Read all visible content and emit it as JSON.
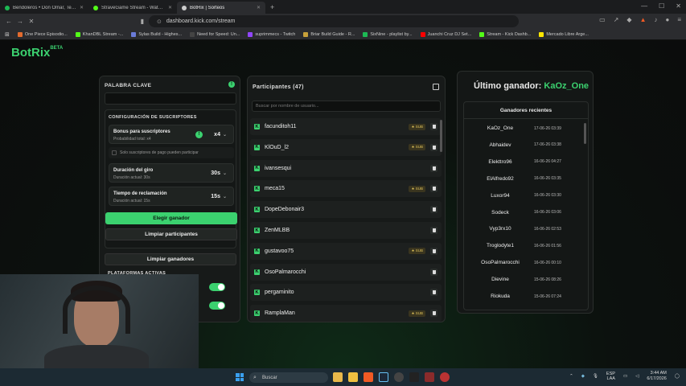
{
  "browser": {
    "tabs": [
      {
        "label": "Bendoleros • Don Omar, Tego Ca",
        "color": "#1db954"
      },
      {
        "label": "StraveGame Stream - Watch Live on",
        "color": "#53fc18"
      },
      {
        "label": "BotRix | Sorteos",
        "color": "#cccccc"
      }
    ],
    "url": "dashboard.kick.com/stream",
    "bookmarks": [
      {
        "label": "One Piece Episodio...",
        "color": "#e36b2e"
      },
      {
        "label": "KhanDBL Stream -...",
        "color": "#53fc18"
      },
      {
        "label": "Sylas Build - Highes...",
        "color": "#6a7bd8"
      },
      {
        "label": "Need for Speed: Un...",
        "color": "#444444"
      },
      {
        "label": "suprimmecs - Twitch",
        "color": "#9146ff"
      },
      {
        "label": "Briar Build Guide - R...",
        "color": "#c7a13a"
      },
      {
        "label": "SixNine - playlist by...",
        "color": "#1db954"
      },
      {
        "label": "Juanchi Cruz DJ Set...",
        "color": "#ff0000"
      },
      {
        "label": "Stream - Kick Dashb...",
        "color": "#53fc18"
      },
      {
        "label": "Mercado Libre Arge...",
        "color": "#ffe600"
      }
    ]
  },
  "app": {
    "logo": "BotRix",
    "logo_badge": "BETA"
  },
  "settings": {
    "keyword_title": "PALABRA CLAVE",
    "keyword_value": "",
    "sub_config_title": "CONFIGURACIÓN DE SUSCRIPTORES",
    "bonus_label": "Bonus para suscriptores",
    "bonus_sub": "Probabilidad total: x4",
    "bonus_value": "x4",
    "paid_only_label": "Solo suscriptores de pago pueden participar",
    "spin_label": "Duración del giro",
    "spin_sub": "Duración actual: 30s",
    "spin_value": "30s",
    "claim_label": "Tiempo de reclamación",
    "claim_sub": "Duración actual: 15s",
    "claim_value": "15s",
    "pick_winner": "Elegir ganador",
    "clear_participants": "Limpiar participantes",
    "clear_winners": "Limpiar ganadores",
    "platforms_title": "PLATAFORMAS ACTIVAS"
  },
  "participants": {
    "title": "Participantes (47)",
    "search_placeholder": "Buscar por nombre de usuario...",
    "sub_label": "SUB",
    "list": [
      {
        "name": "facunditoh11",
        "sub": true
      },
      {
        "name": "KlOuD_l2",
        "sub": true
      },
      {
        "name": "ivansesqui",
        "sub": false
      },
      {
        "name": "meca15",
        "sub": true
      },
      {
        "name": "DopeDebonair3",
        "sub": false
      },
      {
        "name": "ZenMLBB",
        "sub": false
      },
      {
        "name": "gustavoo75",
        "sub": true
      },
      {
        "name": "OsoPalmarocchi",
        "sub": false
      },
      {
        "name": "pergaminito",
        "sub": false
      },
      {
        "name": "RamplaMan",
        "sub": true
      }
    ]
  },
  "winners": {
    "last_winner_label": "Último ganador:",
    "last_winner_name": "KaOz_One",
    "recent_title": "Ganadores recientes",
    "list": [
      {
        "name": "KaOz_One",
        "date": "17-06-26 03:39"
      },
      {
        "name": "Abhaidev",
        "date": "17-06-26 03:38"
      },
      {
        "name": "Elekttro96",
        "date": "16-06-26 04:27"
      },
      {
        "name": "ElAlfredo92",
        "date": "16-06-26 03:35"
      },
      {
        "name": "Luxor94",
        "date": "16-06-26 03:30"
      },
      {
        "name": "Sodeck",
        "date": "16-06-26 03:06"
      },
      {
        "name": "Vyp3rx10",
        "date": "16-06-26 02:53"
      },
      {
        "name": "Troglodyte1",
        "date": "16-06-26 01:56"
      },
      {
        "name": "OsoPalmarocchi",
        "date": "16-06-26 00:10"
      },
      {
        "name": "Dievine",
        "date": "15-06-26 08:26"
      },
      {
        "name": "Riokuda",
        "date": "15-06-26 07:24"
      }
    ]
  },
  "taskbar": {
    "search_label": "Buscar",
    "lang": "ESP",
    "lang2": "LAA",
    "time": "3:44 AM",
    "date": "6/17/2026"
  }
}
